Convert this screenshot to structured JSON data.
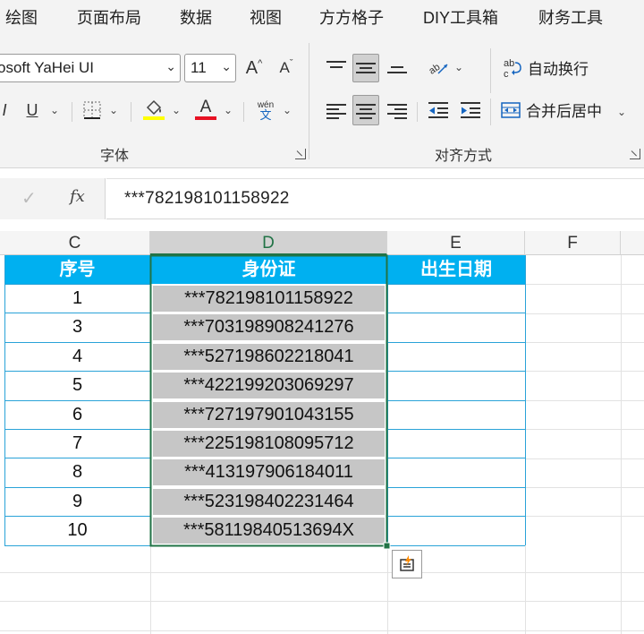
{
  "ribbon_tabs": [
    "绘图",
    "页面布局",
    "数据",
    "视图",
    "方方格子",
    "DIY工具箱",
    "财务工具"
  ],
  "font": {
    "name": "osoft YaHei UI",
    "size": "11",
    "grow_label": "A",
    "shrink_label": "A",
    "group_label": "字体"
  },
  "wrap_text_label": "自动换行",
  "merge_center_label": "合并后居中",
  "align_group_label": "对齐方式",
  "formula_bar": {
    "fx_label": "fx",
    "value": "***782198101158922"
  },
  "columns": [
    "C",
    "D",
    "E",
    "F"
  ],
  "table": {
    "headers": [
      "序号",
      "身份证",
      "出生日期"
    ],
    "rows": [
      [
        "1",
        "***782198101158922"
      ],
      [
        "3",
        "***703198908241276"
      ],
      [
        "4",
        "***527198602218041"
      ],
      [
        "5",
        "***422199203069297"
      ],
      [
        "6",
        "***727197901043155"
      ],
      [
        "7",
        "***225198108095712"
      ],
      [
        "8",
        "***413197906184011"
      ],
      [
        "9",
        "***523198402231464"
      ],
      [
        "10",
        "***58119840513694X"
      ]
    ]
  },
  "colors": {
    "header_fill": "#00b0f0",
    "selection_fill": "#c6c6c6",
    "selection_border": "#217346",
    "font_color_bar": "#e81123",
    "fill_color_bar": "#ffff00"
  },
  "icons": [
    "quick-analysis-icon",
    "fill-color-icon",
    "font-color-icon",
    "border-icon",
    "wrap-text-icon",
    "merge-center-icon"
  ]
}
